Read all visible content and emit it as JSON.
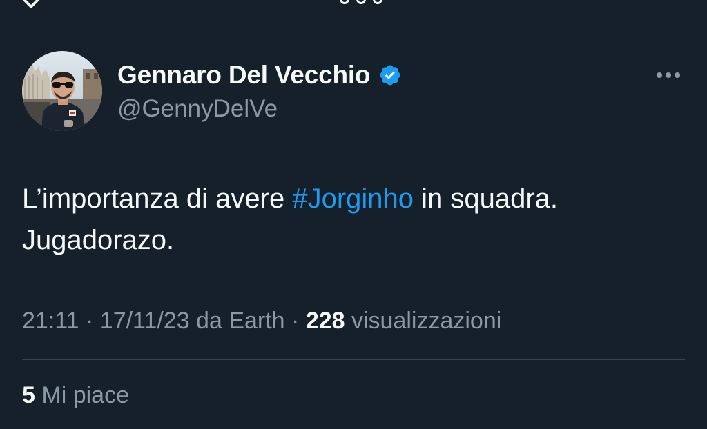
{
  "tweet": {
    "author": {
      "display_name": "Gennaro Del Vecchio",
      "handle": "@GennyDelVe",
      "verified": true,
      "avatar_icon": "profile-photo"
    },
    "text": {
      "before_hashtag": "L’importanza di avere ",
      "hashtag": "#Jorginho",
      "after_hashtag": " in squadra.",
      "second_line": "Jugadorazo."
    },
    "meta": {
      "time": "21:11",
      "sep1": " · ",
      "date": "17/11/23",
      "source": " da Earth",
      "sep2": " · ",
      "views_count": "228",
      "views_label": " visualizzazioni"
    },
    "likes": {
      "count": "5",
      "label": " Mi piace"
    }
  },
  "colors": {
    "background": "#15202b",
    "primary_text": "#f7f9f9",
    "secondary_text": "#8b98a5",
    "accent": "#1d9bf0",
    "divider": "#38444d"
  },
  "icons": {
    "back": "arrow-left-icon",
    "top_more": "more-circles-icon",
    "verified": "verified-badge-icon",
    "more": "more-horizontal-icon"
  }
}
